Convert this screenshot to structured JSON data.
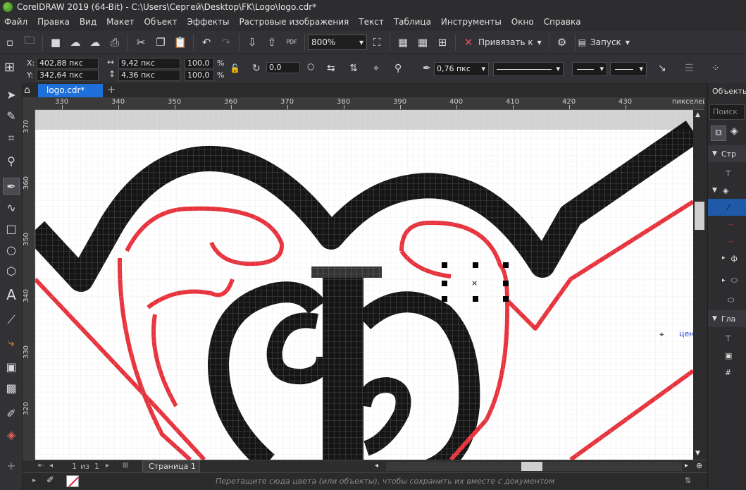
{
  "window": {
    "title": "CorelDRAW 2019 (64-Bit) - C:\\Users\\Сергей\\Desktop\\FK\\Logo\\logo.cdr*"
  },
  "menu": [
    "Файл",
    "Правка",
    "Вид",
    "Макет",
    "Объект",
    "Эффекты",
    "Растровые изображения",
    "Текст",
    "Таблица",
    "Инструменты",
    "Окно",
    "Справка"
  ],
  "toolbar": {
    "zoom": "800%",
    "snap_label": "Привязать к",
    "launch_label": "Запуск",
    "pdf_label": "PDF"
  },
  "properties": {
    "x_label": "X:",
    "x_value": "402,88 пкс",
    "y_label": "Y:",
    "y_value": "342,64 пкс",
    "width_value": "9,42 пкс",
    "height_value": "4,36 пкс",
    "scale_w": "100,0",
    "scale_h": "100,0",
    "percent": "%",
    "rotation": "0,0",
    "outline_width": "0,76 пкс"
  },
  "document": {
    "tab_label": "logo.cdr*",
    "add_tab": "+"
  },
  "ruler": {
    "units": "пикселей",
    "h_ticks": [
      "330",
      "340",
      "350",
      "360",
      "370",
      "380",
      "390",
      "400",
      "410",
      "420",
      "430"
    ],
    "v_ticks": [
      "370",
      "360",
      "350",
      "340",
      "330",
      "320"
    ]
  },
  "canvas": {
    "center_label": "цен"
  },
  "pager": {
    "current": "1",
    "of_label": "из",
    "total": "1",
    "page_tab": "Страница 1"
  },
  "status": {
    "hint": "Перетащите сюда цвета (или объекты), чтобы сохранить их вместе с документом"
  },
  "right_panel": {
    "title": "Объекты",
    "search_placeholder": "Поиск",
    "section1": "Стр",
    "section2": "Гла"
  },
  "colors": {
    "accent": "#1e6fd9",
    "selection_row": "#1e5aa8",
    "ink": "#111111",
    "contour": "#e8323c"
  }
}
